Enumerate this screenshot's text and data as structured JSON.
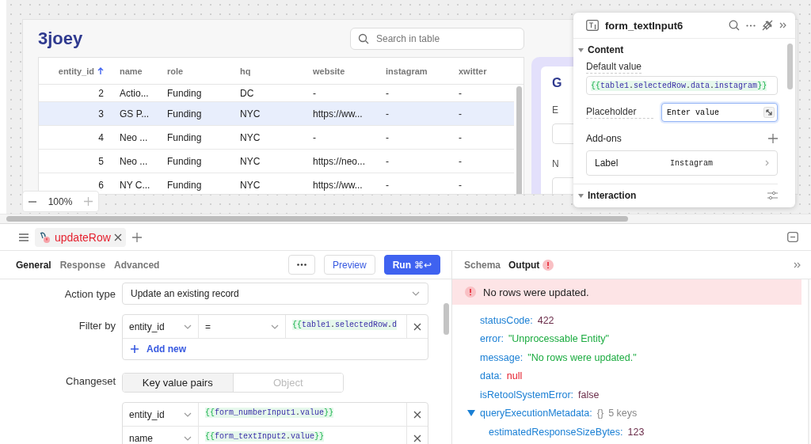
{
  "canvas": {
    "app_title": "3joey",
    "search": {
      "placeholder": "Search in table"
    },
    "table": {
      "columns": [
        {
          "label": "entity_id",
          "sorted": true
        },
        {
          "label": "name",
          "sorted": false
        },
        {
          "label": "role",
          "sorted": false
        },
        {
          "label": "hq",
          "sorted": false
        },
        {
          "label": "website",
          "sorted": false
        },
        {
          "label": "instagram",
          "sorted": false
        },
        {
          "label": "xwitter",
          "sorted": false
        }
      ],
      "rows": [
        {
          "selected": false,
          "cells": [
            "2",
            "Actio...",
            "Funding",
            "DC",
            "-",
            "-",
            "-"
          ]
        },
        {
          "selected": true,
          "cells": [
            "3",
            "GS P...",
            "Funding",
            "NYC",
            "https://ww...",
            "-",
            "-"
          ]
        },
        {
          "selected": false,
          "cells": [
            "4",
            "Neo ...",
            "Funding",
            "NYC",
            "-",
            "-",
            "-"
          ]
        },
        {
          "selected": false,
          "cells": [
            "5",
            "Neo ...",
            "Funding",
            "NYC",
            "https://neo...",
            "-",
            "-"
          ]
        },
        {
          "selected": false,
          "cells": [
            "6",
            "NY C...",
            "Funding",
            "NYC",
            "https://ww...",
            "-",
            "-"
          ]
        }
      ]
    },
    "zoom": {
      "value": "100%"
    },
    "form_card": {
      "title": "G",
      "labels": [
        "E",
        "N"
      ]
    }
  },
  "inspector": {
    "title": "form_textInput6",
    "sections": [
      {
        "title": "Content",
        "expanded": true
      },
      {
        "title": "Interaction",
        "expanded": true
      }
    ],
    "default_value": {
      "label": "Default value",
      "value": "{{table1.selectedRow.data.instagram}}"
    },
    "placeholder": {
      "label": "Placeholder",
      "value": "Enter value"
    },
    "addons": {
      "label": "Add-ons",
      "items": [
        {
          "label": "Label",
          "value": "Instagram"
        }
      ]
    }
  },
  "query_tabs": [
    {
      "name": "updateRow",
      "error": true
    }
  ],
  "editor": {
    "tabs": [
      {
        "label": "General",
        "selected": true
      },
      {
        "label": "Response",
        "selected": false
      },
      {
        "label": "Advanced",
        "selected": false
      }
    ],
    "preview": "Preview",
    "run": "Run",
    "shortcut": "⌘↩",
    "action_type": {
      "label": "Action type",
      "value": "Update an existing record"
    },
    "filter_by": {
      "label": "Filter by",
      "column": "entity_id",
      "operator": "=",
      "value": "{{table1.selectedRow.d",
      "add": "Add new"
    },
    "changeset": {
      "label": "Changeset",
      "modes": [
        {
          "label": "Key value pairs",
          "selected": true
        },
        {
          "label": "Object",
          "selected": false
        }
      ],
      "pairs": [
        {
          "key": "entity_id",
          "value": "{{form_numberInput1.value}}"
        },
        {
          "key": "name",
          "value": "{{form_textInput2.value}}"
        }
      ]
    }
  },
  "output": {
    "tabs": [
      {
        "label": "Schema",
        "selected": false,
        "error": false
      },
      {
        "label": "Output",
        "selected": true,
        "error": true
      }
    ],
    "banner": "No rows were updated.",
    "tree": [
      {
        "key": "statusCode:",
        "value": "422",
        "kind": "number"
      },
      {
        "key": "error:",
        "value": "\"Unprocessable Entity\"",
        "kind": "string"
      },
      {
        "key": "message:",
        "value": "\"No rows were updated.\"",
        "kind": "string"
      },
      {
        "key": "data:",
        "value": "null",
        "kind": "null"
      },
      {
        "key": "isRetoolSystemError:",
        "value": "false",
        "kind": "boolean"
      },
      {
        "key": "queryExecutionMetadata:",
        "kind": "object",
        "summary": "{}",
        "count": "5 keys",
        "expanded": true,
        "children": [
          {
            "key": "estimatedResponseSizeBytes:",
            "value": "123",
            "kind": "number"
          }
        ]
      }
    ]
  }
}
